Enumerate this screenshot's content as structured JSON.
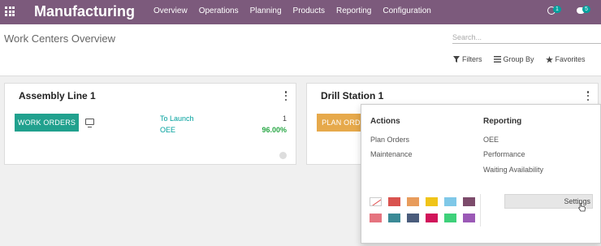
{
  "app": {
    "name": "Manufacturing",
    "menu": [
      "Overview",
      "Operations",
      "Planning",
      "Products",
      "Reporting",
      "Configuration"
    ],
    "activity_count": "1",
    "message_count": "5"
  },
  "control_panel": {
    "breadcrumb": "Work Centers Overview",
    "search_placeholder": "Search...",
    "filters_label": "Filters",
    "group_by_label": "Group By",
    "favorites_label": "Favorites"
  },
  "cards": [
    {
      "title": "Assembly Line 1",
      "button_label": "WORK ORDERS",
      "button_color": "#21a18e",
      "stats": [
        {
          "label": "To Launch",
          "value": "1"
        },
        {
          "label": "OEE",
          "value": "96.00%"
        }
      ]
    },
    {
      "title": "Drill Station 1",
      "button_label": "PLAN ORDERS",
      "button_color": "#e6a94b"
    }
  ],
  "dropdown": {
    "actions_header": "Actions",
    "actions": [
      "Plan Orders",
      "Maintenance"
    ],
    "reporting_header": "Reporting",
    "reporting": [
      "OEE",
      "Performance",
      "Waiting Availability"
    ],
    "settings_label": "Settings",
    "colors": [
      "none",
      "#d9534f",
      "#e89c5c",
      "#f0c419",
      "#7fc8e8",
      "#7c4b6b",
      "#e5747f",
      "#3b8a96",
      "#4a5c7c",
      "#d1145a",
      "#3ed17a",
      "#9b59b6"
    ]
  },
  "theme": {
    "navbar_color": "#7c5a7c",
    "link_color": "#00a09d",
    "success_color": "#28a745"
  }
}
